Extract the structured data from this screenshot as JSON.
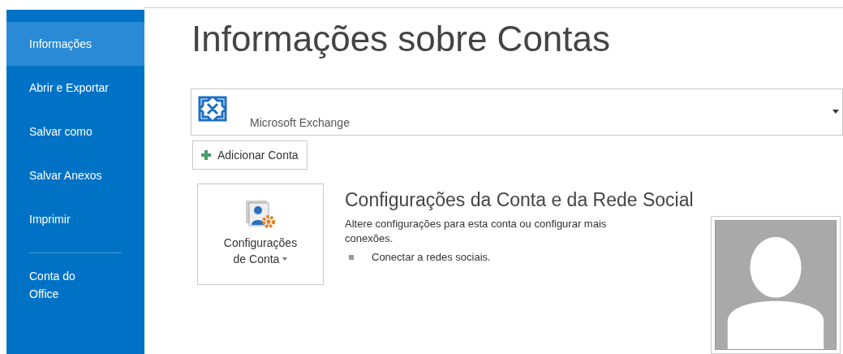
{
  "sidebar": {
    "items": [
      {
        "label": "Informações",
        "selected": true
      },
      {
        "label": "Abrir e Exportar",
        "selected": false
      },
      {
        "label": "Salvar como",
        "selected": false
      },
      {
        "label": "Salvar Anexos",
        "selected": false
      },
      {
        "label": "Imprimir",
        "selected": false
      },
      {
        "label": "Conta do Office",
        "selected": false,
        "divider_before": true
      }
    ]
  },
  "title": "Informações sobre Contas",
  "account_selector": {
    "value": "Microsoft Exchange"
  },
  "add_account_button": "Adicionar Conta",
  "settings_button": {
    "label_line_1": "Configurações",
    "label_line_2": "de Conta"
  },
  "section": {
    "heading": "Configurações da Conta e da Rede Social",
    "description": "Altere configurações para esta conta ou configurar mais conexões.",
    "bullets": [
      "Conectar a redes sociais."
    ]
  }
}
